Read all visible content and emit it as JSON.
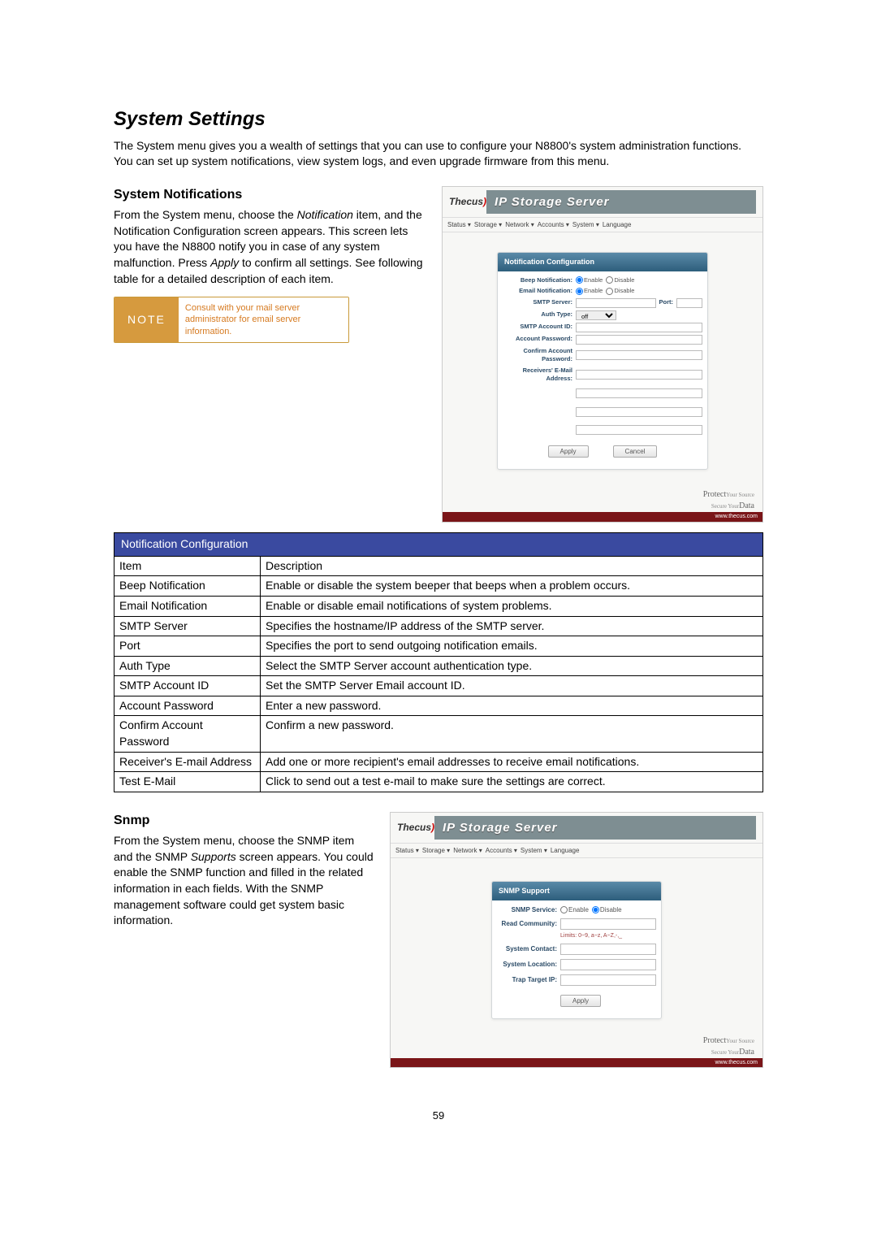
{
  "page_number": "59",
  "heading": "System Settings",
  "intro": "The System menu gives you a wealth of settings that you can use to configure your N8800's system administration functions. You can set up system notifications, view system logs, and even upgrade firmware from this menu.",
  "notifications": {
    "title": "System Notifications",
    "body_p1_a": "From the System menu, choose the ",
    "body_p1_em": "Notification",
    "body_p1_b": " item, and the Notification Configuration screen appears. This screen lets you have the N8800 notify you in case of any system malfunction. Press ",
    "body_p1_em2": "Apply",
    "body_p1_c": " to confirm all settings. See following table for a detailed description of each item."
  },
  "note": {
    "tag": "NOTE",
    "text": "Consult with your mail server administrator for email server information."
  },
  "screenshot1": {
    "brand": "Thecus",
    "banner": "IP Storage Server",
    "nav": [
      "Status ▾",
      "Storage ▾",
      "Network ▾",
      "Accounts ▾",
      "System ▾",
      "Language"
    ],
    "form_title": "Notification Configuration",
    "rows": {
      "beep": {
        "label": "Beep Notification:",
        "opt_enable": "Enable",
        "opt_disable": "Disable"
      },
      "email": {
        "label": "Email Notification:",
        "opt_enable": "Enable",
        "opt_disable": "Disable"
      },
      "smtp": {
        "label": "SMTP Server:",
        "port_label": "Port:"
      },
      "auth": {
        "label": "Auth Type:",
        "value": "off"
      },
      "acct": {
        "label": "SMTP Account ID:"
      },
      "pwd": {
        "label": "Account Password:"
      },
      "confpwd": {
        "label": "Confirm Account Password:"
      },
      "recv": {
        "label": "Receivers' E-Mail Address:"
      }
    },
    "apply": "Apply",
    "cancel": "Cancel",
    "footer_a": "Protect",
    "footer_b": "Your Source",
    "footer_c": "Secure Your",
    "footer_d": "Data",
    "footbar": "www.thecus.com"
  },
  "config_table": {
    "title": "Notification Configuration",
    "col1": "Item",
    "col2": "Description",
    "rows": [
      {
        "item": "Beep Notification",
        "desc": "Enable or disable the system beeper that beeps when a problem occurs."
      },
      {
        "item": "Email Notification",
        "desc": "Enable or disable email notifications of system problems."
      },
      {
        "item": "SMTP Server",
        "desc": "Specifies the hostname/IP address of the SMTP server."
      },
      {
        "item": "Port",
        "desc": "Specifies the port to send outgoing notification emails."
      },
      {
        "item": "Auth Type",
        "desc": "Select the SMTP Server account authentication type."
      },
      {
        "item": "SMTP Account ID",
        "desc": "Set the SMTP Server Email account ID."
      },
      {
        "item": "Account Password",
        "desc": "Enter a new password."
      },
      {
        "item": "Confirm Account Password",
        "desc": "Confirm a new password."
      },
      {
        "item": "Receiver's E-mail Address",
        "desc": "Add one or more recipient's email addresses to receive email notifications."
      },
      {
        "item": "Test E-Mail",
        "desc": "Click to send out a test e-mail to make sure the settings are correct."
      }
    ]
  },
  "snmp": {
    "title": "Snmp",
    "body_a": "From the System menu, choose the SNMP item and the SNMP ",
    "body_em": "Supports",
    "body_b": " screen appears. You could enable the SNMP function and filled in the related information in each fields. With the SNMP management software could get system basic information."
  },
  "screenshot2": {
    "brand": "Thecus",
    "banner": "IP Storage Server",
    "nav": [
      "Status ▾",
      "Storage ▾",
      "Network ▾",
      "Accounts ▾",
      "System ▾",
      "Language"
    ],
    "form_title": "SNMP Support",
    "rows": {
      "service": {
        "label": "SNMP Service:",
        "opt_enable": "Enable",
        "opt_disable": "Disable"
      },
      "community": {
        "label": "Read Community:",
        "hint": "Limits: 0~9, a~z, A~Z,-,_"
      },
      "contact": {
        "label": "System Contact:"
      },
      "location": {
        "label": "System Location:"
      },
      "trap": {
        "label": "Trap Target IP:"
      }
    },
    "apply": "Apply",
    "footer_a": "Protect",
    "footer_b": "Your Source",
    "footer_c": "Secure Your",
    "footer_d": "Data",
    "footbar": "www.thecus.com"
  }
}
